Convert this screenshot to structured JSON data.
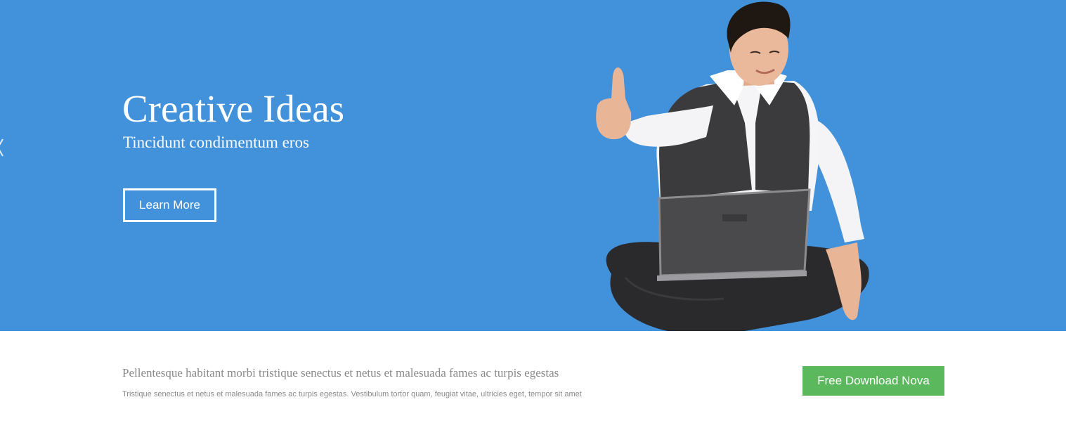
{
  "hero": {
    "title": "Creative Ideas",
    "subtitle": "Tincidunt condimentum eros",
    "button_label": "Learn More",
    "background_color": "#4291db",
    "prev_icon": "chevron-left-icon",
    "image": "man-thumbs-up-with-laptop"
  },
  "cta": {
    "heading": "Pellentesque habitant morbi tristique senectus et netus et malesuada fames ac turpis egestas",
    "text": "Tristique senectus et netus et malesuada fames ac turpis egestas. Vestibulum tortor quam, feugiat vitae, ultricies eget, tempor sit amet",
    "button_label": "Free Download Nova",
    "button_color": "#5cb85c"
  }
}
